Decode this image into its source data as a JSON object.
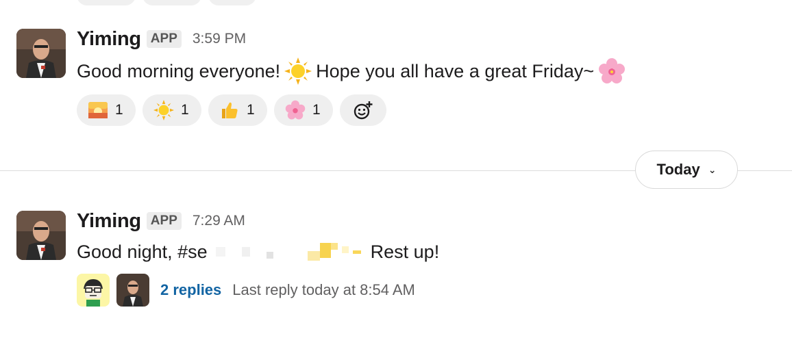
{
  "messages": [
    {
      "sender": "Yiming",
      "badge": "APP",
      "time": "3:59 PM",
      "text_part1": "Good morning everyone!",
      "text_part2": "Hope you all have a great Friday~",
      "reactions": [
        {
          "emoji": "sunrise-icon",
          "count": "1"
        },
        {
          "emoji": "sun-icon",
          "count": "1"
        },
        {
          "emoji": "thumbs-up-icon",
          "count": "1"
        },
        {
          "emoji": "cherry-blossom-icon",
          "count": "1"
        }
      ]
    },
    {
      "sender": "Yiming",
      "badge": "APP",
      "time": "7:29 AM",
      "text_part1": "Good night, #se",
      "text_part2": "Rest up!",
      "thread": {
        "replies": "2 replies",
        "last_reply": "Last reply today at 8:54 AM"
      }
    }
  ],
  "divider": {
    "label": "Today"
  },
  "colors": {
    "link": "#1264a3",
    "reaction_bg": "#efefef",
    "badge_bg": "#ececec"
  }
}
